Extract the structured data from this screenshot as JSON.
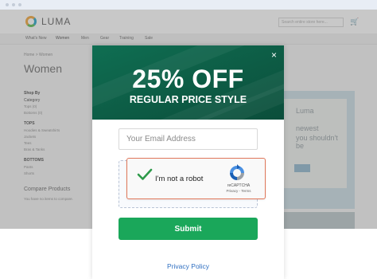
{
  "background_page": {
    "logo_text": "LUMA",
    "search_placeholder": "Search entire store here...",
    "nav_items": [
      "What's New",
      "Women",
      "Men",
      "Gear",
      "Training",
      "Sale"
    ],
    "breadcrumb": "Home > Women",
    "page_title": "Women",
    "sidebar": {
      "shop_by": "Shop By",
      "category_heading": "Category",
      "category_links": [
        "Tops (0)",
        "Bottoms (0)"
      ],
      "tops_heading": "TOPS",
      "tops_links": [
        "Hoodies & Sweatshirts",
        "Jackets",
        "Tees",
        "Bras & Tanks"
      ],
      "bottoms_heading": "BOTTOMS",
      "bottoms_links": [
        "Pants",
        "Shorts"
      ],
      "compare_heading": "Compare Products",
      "compare_text": "You have no items to compare."
    },
    "promo_lines": [
      "Luma",
      "newest",
      "you shouldn't be"
    ]
  },
  "modal": {
    "headline": "25% OFF",
    "subheadline": "REGULAR PRICE STYLE",
    "close_symbol": "×",
    "email_placeholder": "Your Email Address",
    "captcha": {
      "label": "I'm not a robot",
      "brand": "reCAPTCHA",
      "links": "Privacy - Terms"
    },
    "submit_label": "Submit",
    "privacy_link": "Privacy Policy"
  },
  "colors": {
    "banner": "#0f6e52",
    "submit": "#1aa75a",
    "check": "#2e9a4a",
    "link": "#2f6fc1"
  },
  "icons": [
    "logo-icon",
    "cart-icon",
    "close-icon",
    "checkmark-icon",
    "recaptcha-icon"
  ]
}
